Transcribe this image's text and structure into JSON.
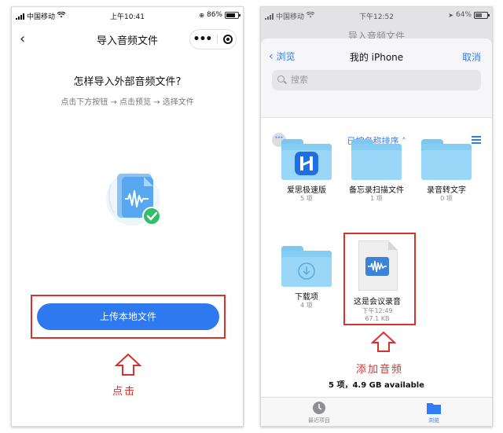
{
  "left": {
    "status": {
      "carrier": "中国移动",
      "time": "上午10:41",
      "battery": "86%"
    },
    "nav": {
      "title": "导入音频文件"
    },
    "question": "怎样导入外部音频文件?",
    "steps": "点击下方按钮 → 点击预览 → 选择文件",
    "upload_button": "上传本地文件",
    "annotation": "点击"
  },
  "right": {
    "status": {
      "carrier": "中国移动",
      "time": "下午12:52",
      "battery": "64%"
    },
    "behind_title": "导入音频文件",
    "header": {
      "back": "浏览",
      "title": "我的 iPhone",
      "cancel": "取消"
    },
    "search": {
      "placeholder": "搜索"
    },
    "sort_label": "已按名称排序",
    "items": [
      {
        "name": "爱思极速版",
        "sub": "5 项"
      },
      {
        "name": "备忘录扫描文件",
        "sub": "1 项"
      },
      {
        "name": "录音转文字",
        "sub": "0 项"
      },
      {
        "name": "下载项",
        "sub": "4 项"
      },
      {
        "name": "这是会议录音",
        "time": "下午12:49",
        "size": "67.1 KB"
      }
    ],
    "annotation": "添加音频",
    "totals": "5 项，4.9 GB available",
    "tabs": [
      {
        "label": "最近项目"
      },
      {
        "label": "浏览"
      }
    ]
  },
  "colors": {
    "accent": "#2f7cf6",
    "button": "#2e78f0",
    "annotation": "#d9322c",
    "folder": "#86cdf4"
  }
}
